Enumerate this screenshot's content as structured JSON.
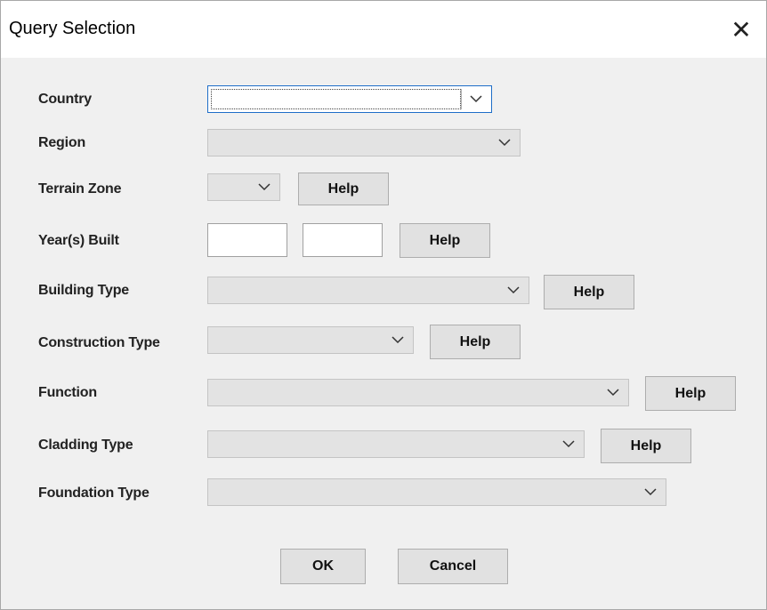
{
  "dialog": {
    "title": "Query Selection",
    "close_glyph": "✕"
  },
  "fields": {
    "country": {
      "label": "Country",
      "value": ""
    },
    "region": {
      "label": "Region",
      "value": ""
    },
    "terrain_zone": {
      "label": "Terrain Zone",
      "value": "",
      "help": "Help"
    },
    "years_built": {
      "label": "Year(s) Built",
      "from": "",
      "to": "",
      "help": "Help"
    },
    "building_type": {
      "label": "Building Type",
      "value": "",
      "help": "Help"
    },
    "construction_type": {
      "label": "Construction Type",
      "value": "",
      "help": "Help"
    },
    "function": {
      "label": "Function",
      "value": "",
      "help": "Help"
    },
    "cladding_type": {
      "label": "Cladding Type",
      "value": "",
      "help": "Help"
    },
    "foundation_type": {
      "label": "Foundation Type",
      "value": ""
    }
  },
  "buttons": {
    "ok": "OK",
    "cancel": "Cancel"
  },
  "icons": {
    "dropdown": "chevron-down-icon",
    "close": "close-icon"
  }
}
